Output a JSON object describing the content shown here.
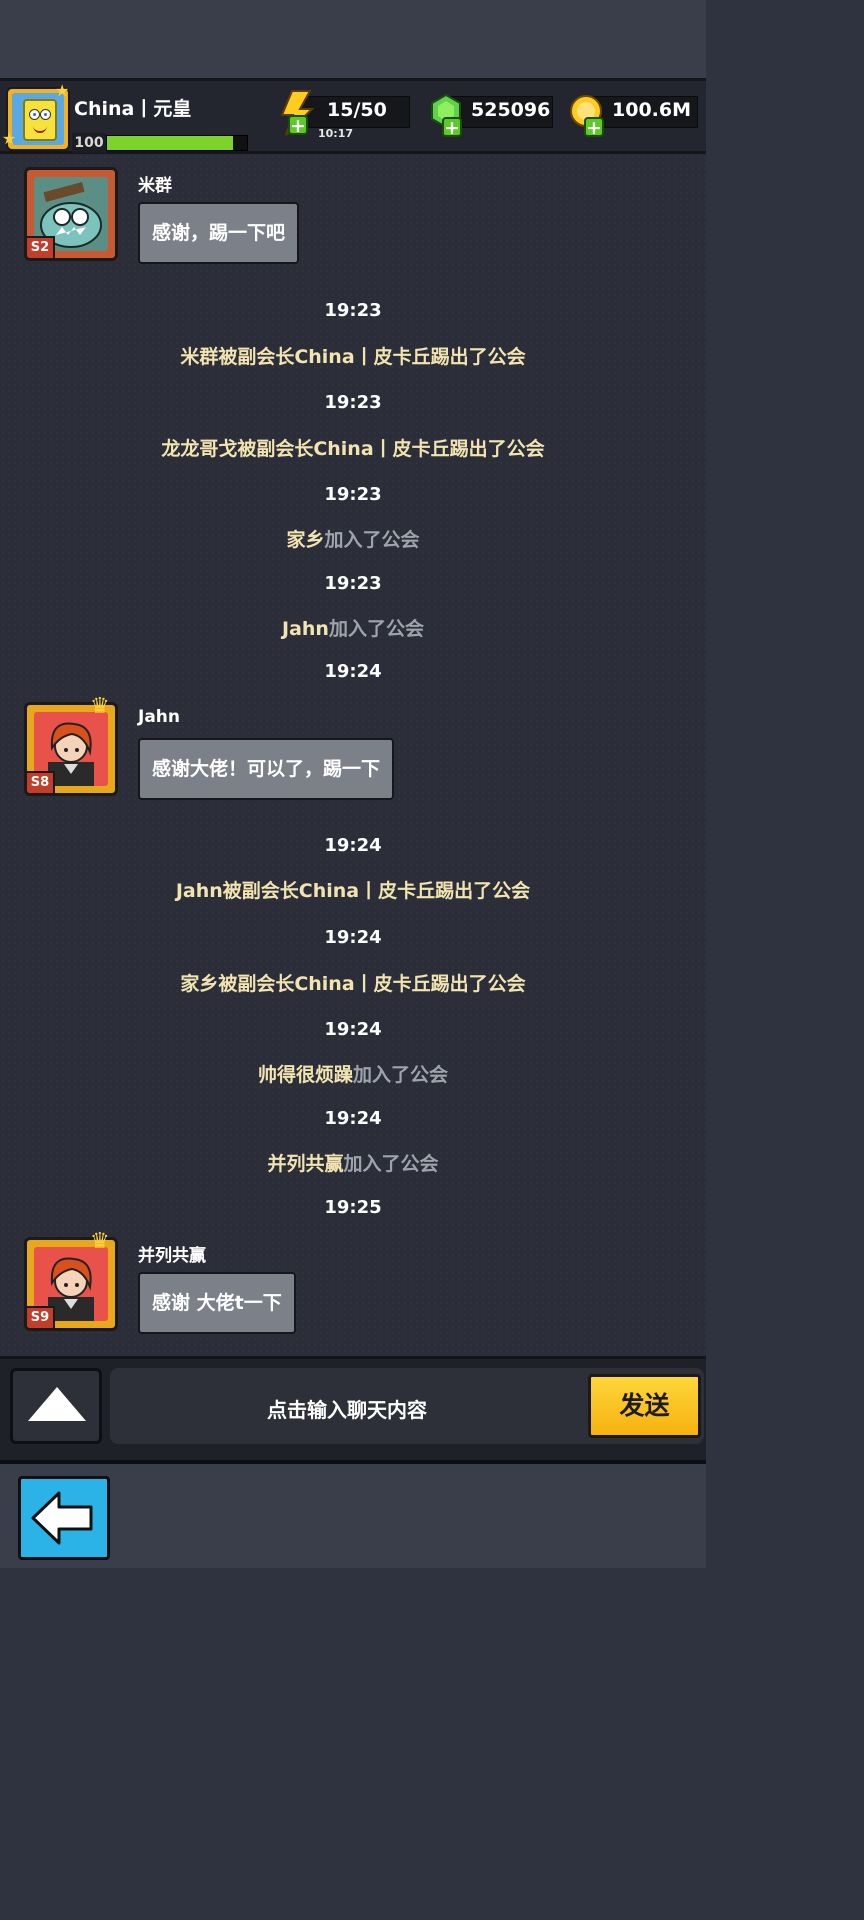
{
  "header": {
    "player_name": "China丨元皇",
    "level": "100",
    "xp_fraction": 0.9,
    "energy": "15/50",
    "energy_timer": "10:17",
    "gems": "525096",
    "gold": "100.6M"
  },
  "chat": {
    "msg1": {
      "sender": "米群",
      "text": "感谢，踢一下吧",
      "season": "S2"
    },
    "t1": "19:23",
    "s1": {
      "name": "米群",
      "text": "被副会长China丨皮卡丘踢出了公会"
    },
    "t2": "19:23",
    "s2": {
      "name": "龙龙哥戈",
      "text": "被副会长China丨皮卡丘踢出了公会"
    },
    "t3": "19:23",
    "s3": {
      "name": "家乡",
      "text": "加入了公会"
    },
    "t4": "19:23",
    "s4": {
      "name": "Jahn",
      "text": "加入了公会"
    },
    "t5": "19:24",
    "msg2": {
      "sender": "Jahn",
      "text": "感谢大佬！可以了，踢一下",
      "season": "S8"
    },
    "t6": "19:24",
    "s5": {
      "name": "Jahn",
      "text": "被副会长China丨皮卡丘踢出了公会"
    },
    "t7": "19:24",
    "s6": {
      "name": "家乡",
      "text": "被副会长China丨皮卡丘踢出了公会"
    },
    "t8": "19:24",
    "s7": {
      "name": "帅得很烦躁",
      "text": "加入了公会"
    },
    "t9": "19:24",
    "s8": {
      "name": "并列共赢",
      "text": "加入了公会"
    },
    "t10": "19:25",
    "msg3": {
      "sender": "并列共赢",
      "text": "感谢 大佬t一下",
      "season": "S9"
    }
  },
  "input": {
    "placeholder": "点击输入聊天内容",
    "send_label": "发送"
  },
  "icons": [
    "energy-bolt-icon",
    "gem-icon",
    "gold-coin-icon",
    "plus-icon",
    "crown-icon",
    "up-arrow-icon",
    "back-arrow-icon"
  ],
  "colors": {
    "highlight_name": "#f2e4b0",
    "system_text": "#9fa3ab",
    "send_button": "#ffc826",
    "back_button": "#2bb3e8",
    "xp_bar": "#7dd32b"
  }
}
